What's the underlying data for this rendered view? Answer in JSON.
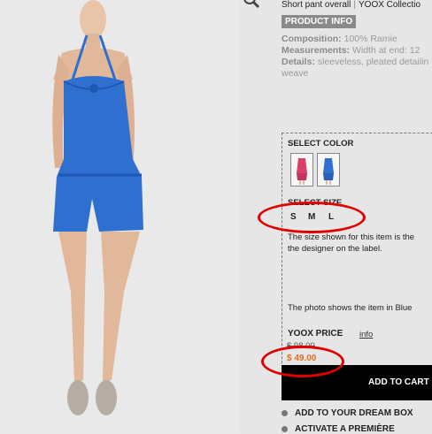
{
  "product": {
    "title": "Short pant overall",
    "brand": "YOOX Collectio",
    "tab_label": "PRODUCT INFO",
    "composition_label": "Composition:",
    "composition_value": " 100% Ramie",
    "measurements_label": "Measurements:",
    "measurements_value": " Width at end: 12",
    "details_label": "Details:",
    "details_value": " sleeveless, pleated detailin",
    "details_cont": "weave"
  },
  "selector": {
    "color_label": "SELECT COLOR",
    "colors": [
      "pink",
      "blue"
    ],
    "size_label": "SELECT SIZE",
    "sizes": [
      "S",
      "M",
      "L"
    ],
    "size_note_1": "The size shown for this item is the",
    "size_note_2": "the designer on the label.",
    "photo_note": "The photo shows the item in Blue",
    "price_label": "YOOX PRICE",
    "info_link": "info",
    "old_price": "$ 98.00",
    "price": "$ 49.00",
    "cart_label": "ADD TO CART"
  },
  "actions": {
    "dream_box": "ADD TO YOUR DREAM BOX",
    "premiere": "ACTIVATE A PREMIÈRE"
  },
  "colors": {
    "accent_price": "#e07020",
    "annotation": "#e00000",
    "garment": "#2f6fd0"
  }
}
